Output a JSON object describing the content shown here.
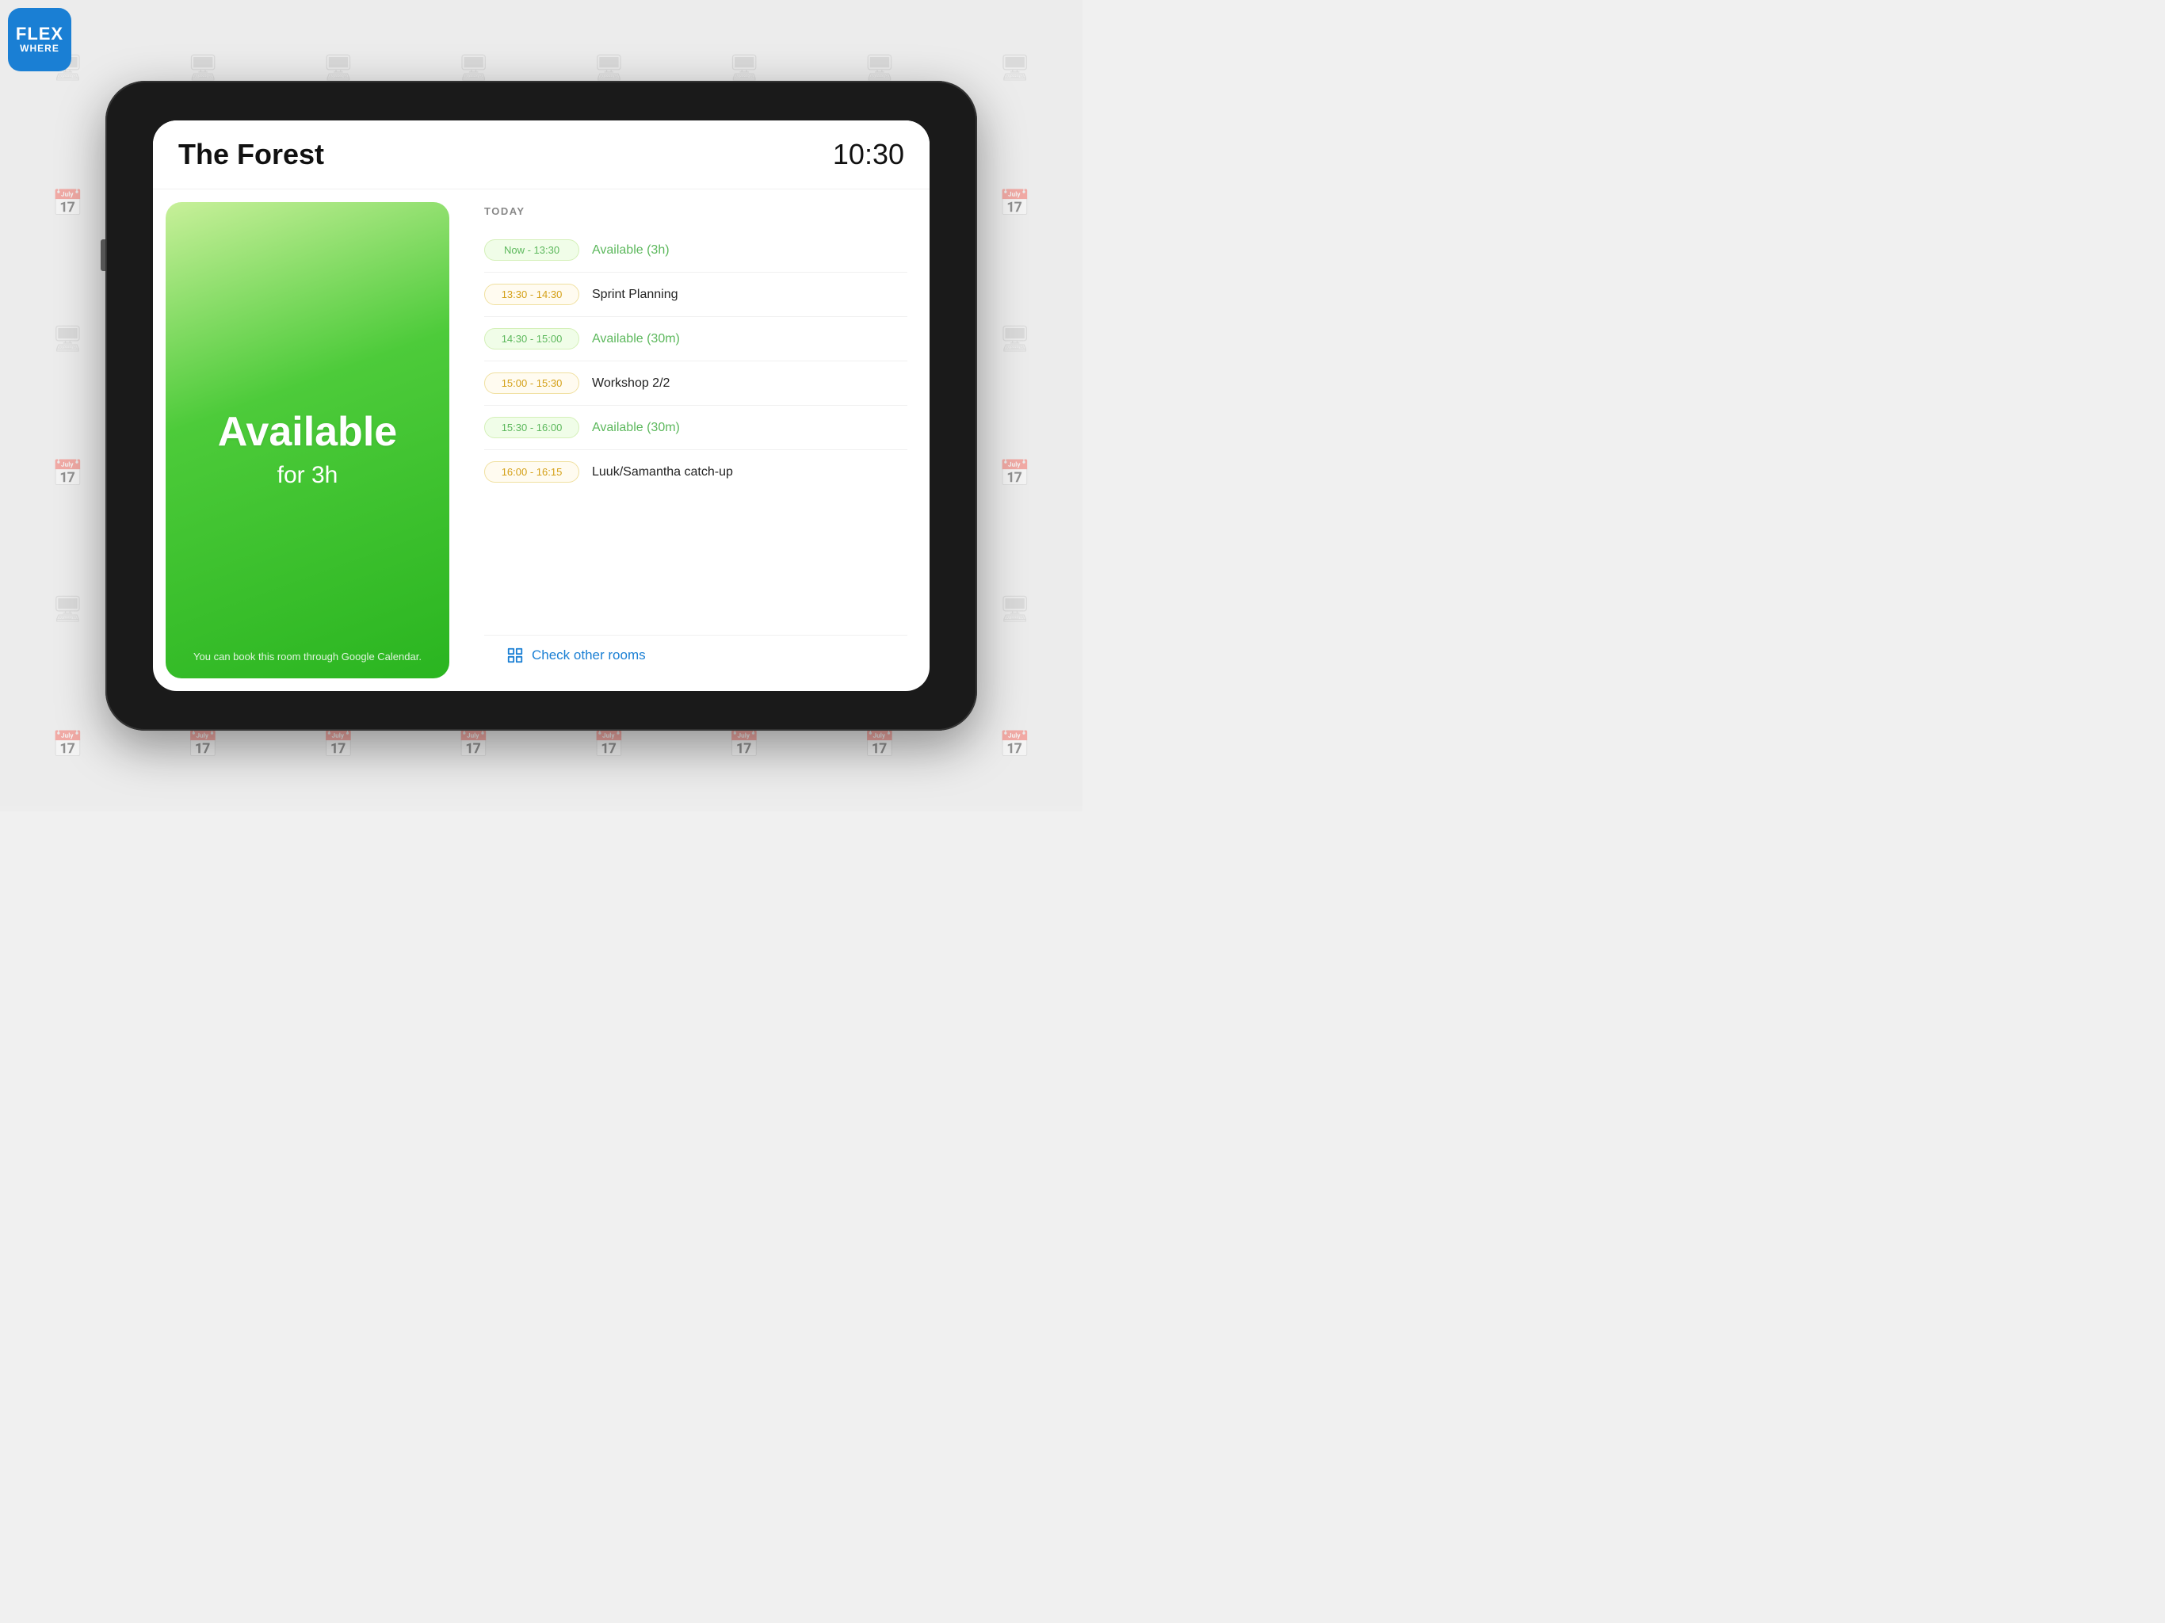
{
  "logo": {
    "flex": "FLEX",
    "where": "WHERE"
  },
  "header": {
    "room_name": "The Forest",
    "current_time": "10:30"
  },
  "availability": {
    "status": "Available",
    "duration": "for 3h",
    "book_hint": "You can book this room through Google Calendar."
  },
  "schedule": {
    "today_label": "TODAY",
    "items": [
      {
        "time": "Now - 13:30",
        "event": "Available (3h)",
        "type": "available"
      },
      {
        "time": "13:30 - 14:30",
        "event": "Sprint Planning",
        "type": "busy"
      },
      {
        "time": "14:30 - 15:00",
        "event": "Available (30m)",
        "type": "available"
      },
      {
        "time": "15:00 - 15:30",
        "event": "Workshop 2/2",
        "type": "busy"
      },
      {
        "time": "15:30 - 16:00",
        "event": "Available (30m)",
        "type": "available"
      },
      {
        "time": "16:00 - 16:15",
        "event": "Luuk/Samantha catch-up",
        "type": "busy"
      }
    ]
  },
  "footer": {
    "check_rooms_label": "Check other rooms"
  }
}
